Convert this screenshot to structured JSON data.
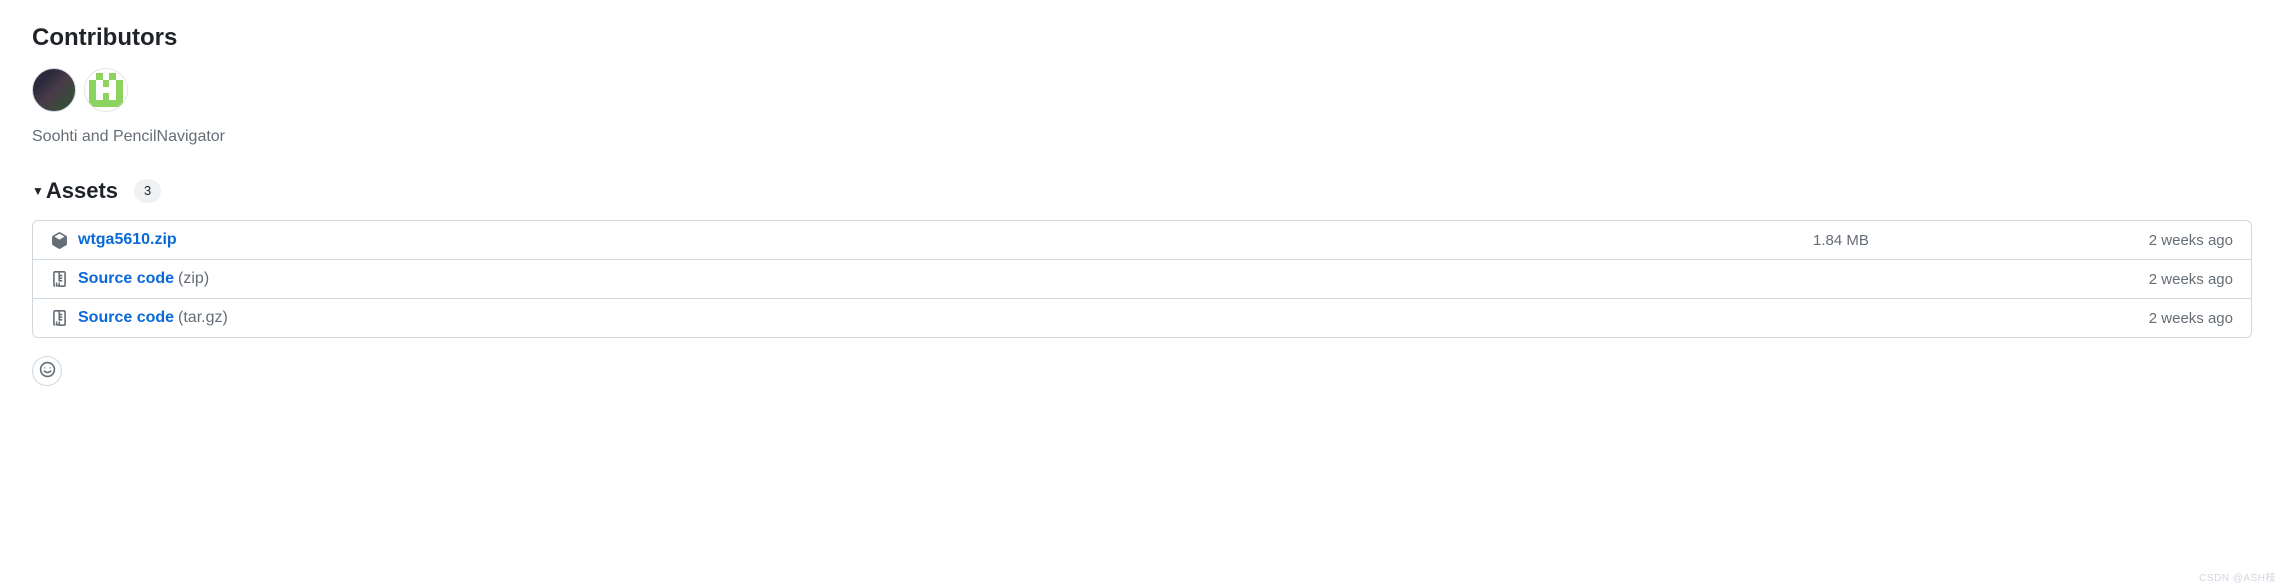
{
  "contributors": {
    "title": "Contributors",
    "names": "Soohti and PencilNavigator"
  },
  "assets": {
    "title": "Assets",
    "count": "3",
    "items": [
      {
        "icon": "package-icon",
        "name": "wtga5610.zip",
        "format": "",
        "size": "1.84 MB",
        "date": "2 weeks ago"
      },
      {
        "icon": "file-zip-icon",
        "name": "Source code",
        "format": "(zip)",
        "size": "",
        "date": "2 weeks ago"
      },
      {
        "icon": "file-zip-icon",
        "name": "Source code",
        "format": "(tar.gz)",
        "size": "",
        "date": "2 weeks ago"
      }
    ]
  },
  "watermark": "CSDN @ASH枝"
}
